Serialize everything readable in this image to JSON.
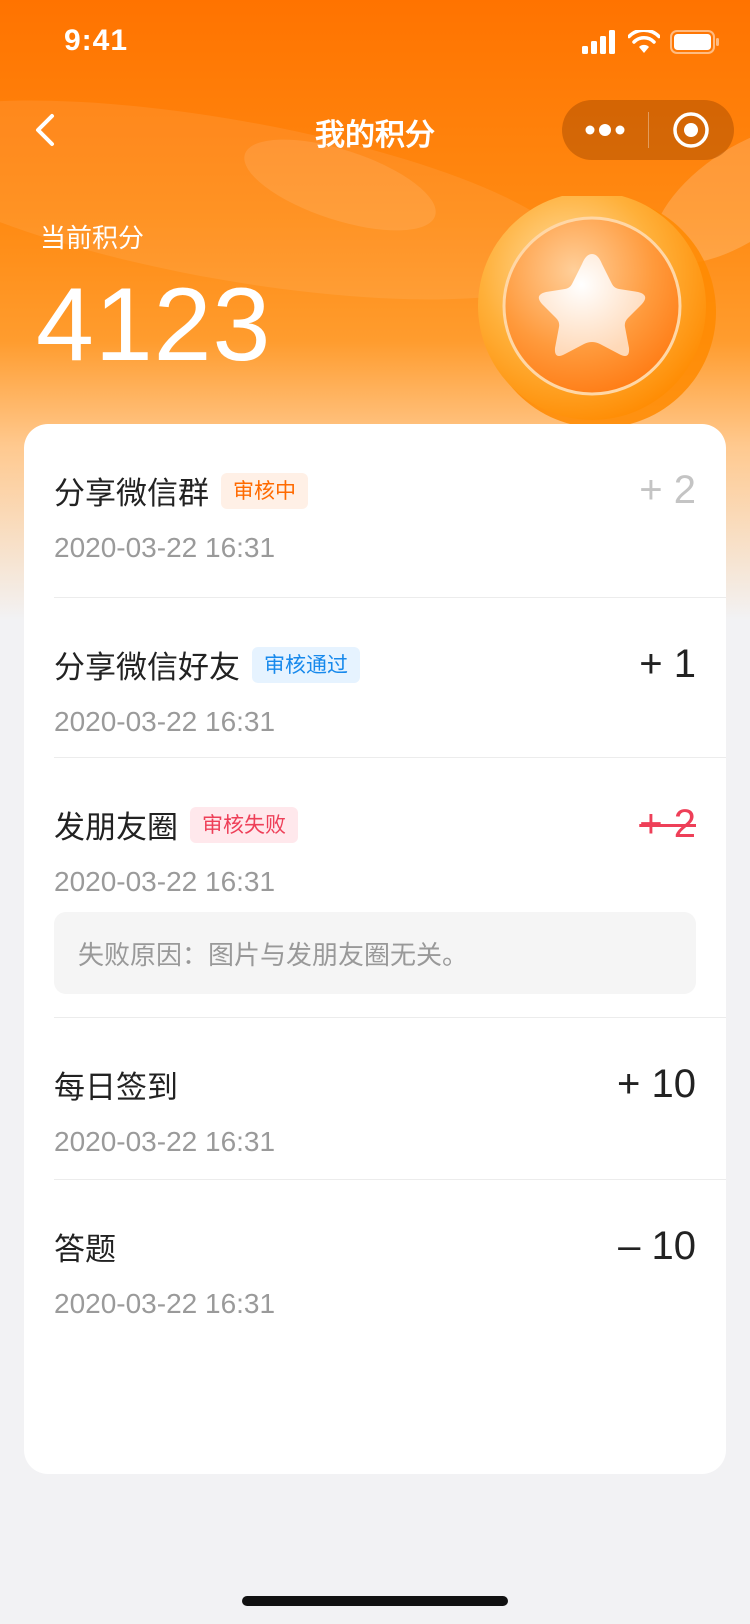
{
  "status_bar": {
    "time": "9:41"
  },
  "nav": {
    "title": "我的积分"
  },
  "summary": {
    "label": "当前积分",
    "value": "4123"
  },
  "records": [
    {
      "title": "分享微信群",
      "tag": "审核中",
      "tag_type": "pending",
      "date": "2020-03-22 16:31",
      "points": "+ 2",
      "points_style": "muted"
    },
    {
      "title": "分享微信好友",
      "tag": "审核通过",
      "tag_type": "approved",
      "date": "2020-03-22 16:31",
      "points": "+ 1",
      "points_style": "normal"
    },
    {
      "title": "发朋友圈",
      "tag": "审核失败",
      "tag_type": "failed",
      "date": "2020-03-22 16:31",
      "points": "+ 2",
      "points_style": "failed",
      "fail_reason": "失败原因：图片与发朋友圈无关。"
    },
    {
      "title": "每日签到",
      "date": "2020-03-22 16:31",
      "points": "+ 10",
      "points_style": "normal"
    },
    {
      "title": "答题",
      "date": "2020-03-22 16:31",
      "points": "– 10",
      "points_style": "normal"
    }
  ],
  "icons": {
    "back": "chevron-left-icon",
    "more": "more-dots-icon",
    "close": "target-close-icon",
    "coin": "star-coin-icon",
    "signal": "signal-icon",
    "wifi": "wifi-icon",
    "battery": "battery-icon"
  },
  "colors": {
    "header_orange": "#ff7300",
    "pending": "#ff6a00",
    "approved": "#1789ec",
    "failed": "#ee3f58"
  }
}
